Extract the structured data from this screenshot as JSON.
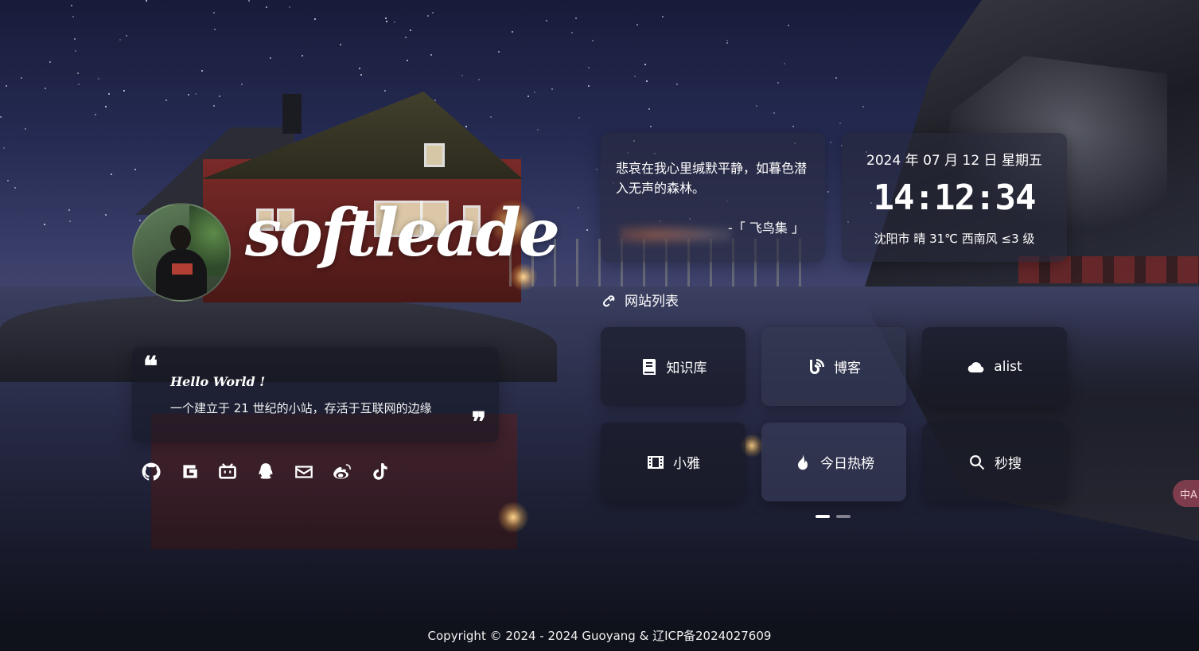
{
  "profile": {
    "site_name": "softleade"
  },
  "intro": {
    "quote_open": "❝",
    "quote_close": "❞",
    "title": "Hello World !",
    "description": "一个建立于 21 世纪的小站，存活于互联网的边缘"
  },
  "social": [
    {
      "icon": "github-icon"
    },
    {
      "icon": "gitee-icon"
    },
    {
      "icon": "bilibili-icon"
    },
    {
      "icon": "qq-icon"
    },
    {
      "icon": "email-icon"
    },
    {
      "icon": "weibo-icon"
    },
    {
      "icon": "tiktok-icon"
    }
  ],
  "poem": {
    "text": "悲哀在我心里缄默平静，如暮色潜入无声的森林。",
    "author": "-「 飞鸟集 」"
  },
  "clock": {
    "date": "2024 年 07 月 12 日 星期五",
    "time": "14:12:34",
    "weather": "沈阳市 晴 31℃  西南风  ≤3 级"
  },
  "links": {
    "title": "网站列表",
    "title_icon": "link-icon",
    "items": [
      {
        "label": "知识库",
        "icon": "book-icon"
      },
      {
        "label": "博客",
        "icon": "blog-icon"
      },
      {
        "label": "alist",
        "icon": "cloud-icon"
      },
      {
        "label": "小雅",
        "icon": "film-icon"
      },
      {
        "label": "今日热榜",
        "icon": "fire-icon"
      },
      {
        "label": "秒搜",
        "icon": "search-icon"
      }
    ],
    "pages": 2,
    "active_page": 1
  },
  "translate": {
    "label": "中A",
    "icon": "translate-icon"
  },
  "footer": {
    "copyright": "Copyright © 2024 - 2024 Guoyang & 辽ICP备2024027609"
  },
  "colors": {
    "card_bg": "#1a1c2a",
    "text": "#ffffff",
    "accent_translate": "#c85064"
  }
}
